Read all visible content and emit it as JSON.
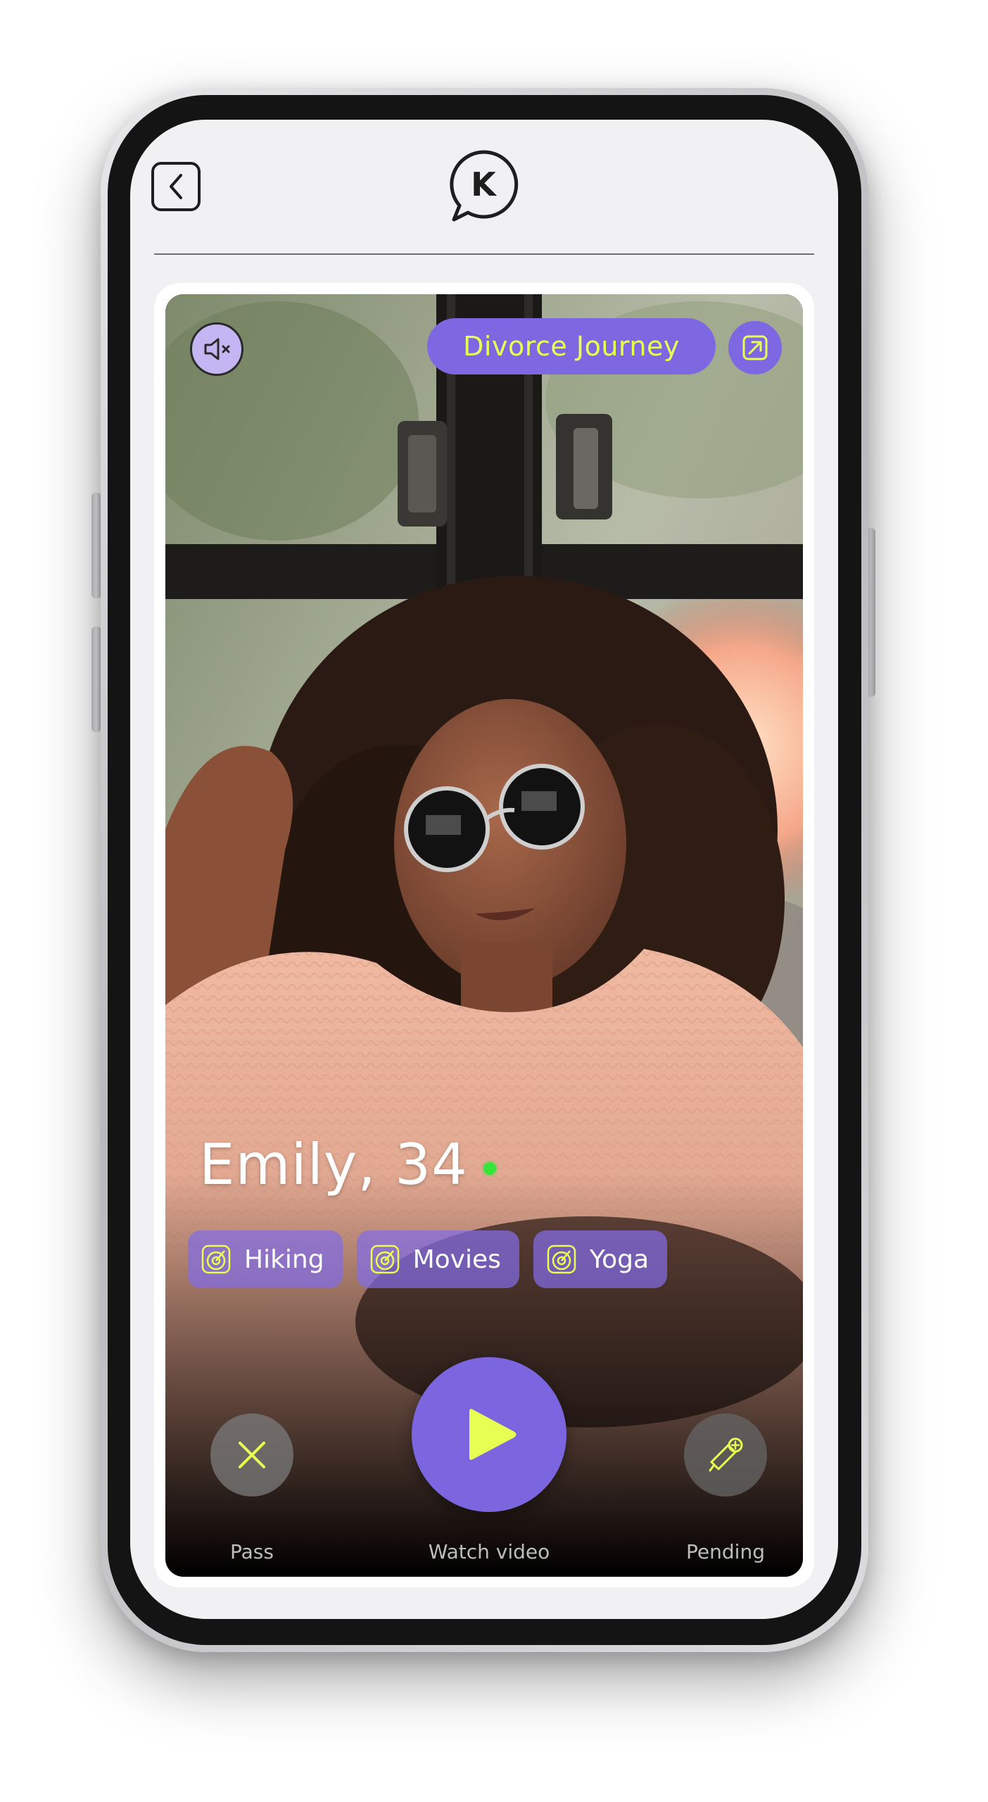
{
  "header": {
    "back_icon": "chevron-left-icon",
    "logo_letter": "K"
  },
  "profile": {
    "journey_label": "Divorce Journey",
    "name_age": "Emily, 34",
    "online": true,
    "interests": [
      {
        "label": "Hiking",
        "icon": "target-icon"
      },
      {
        "label": "Movies",
        "icon": "target-icon"
      },
      {
        "label": "Yoga",
        "icon": "target-icon"
      }
    ]
  },
  "actions": {
    "pass_label": "Pass",
    "watch_label": "Watch video",
    "pending_label": "Pending"
  },
  "colors": {
    "accent_purple": "#7e68e2",
    "accent_lime": "#e7ff52",
    "online_green": "#36e53a",
    "screen_bg": "#f1f1f3"
  }
}
